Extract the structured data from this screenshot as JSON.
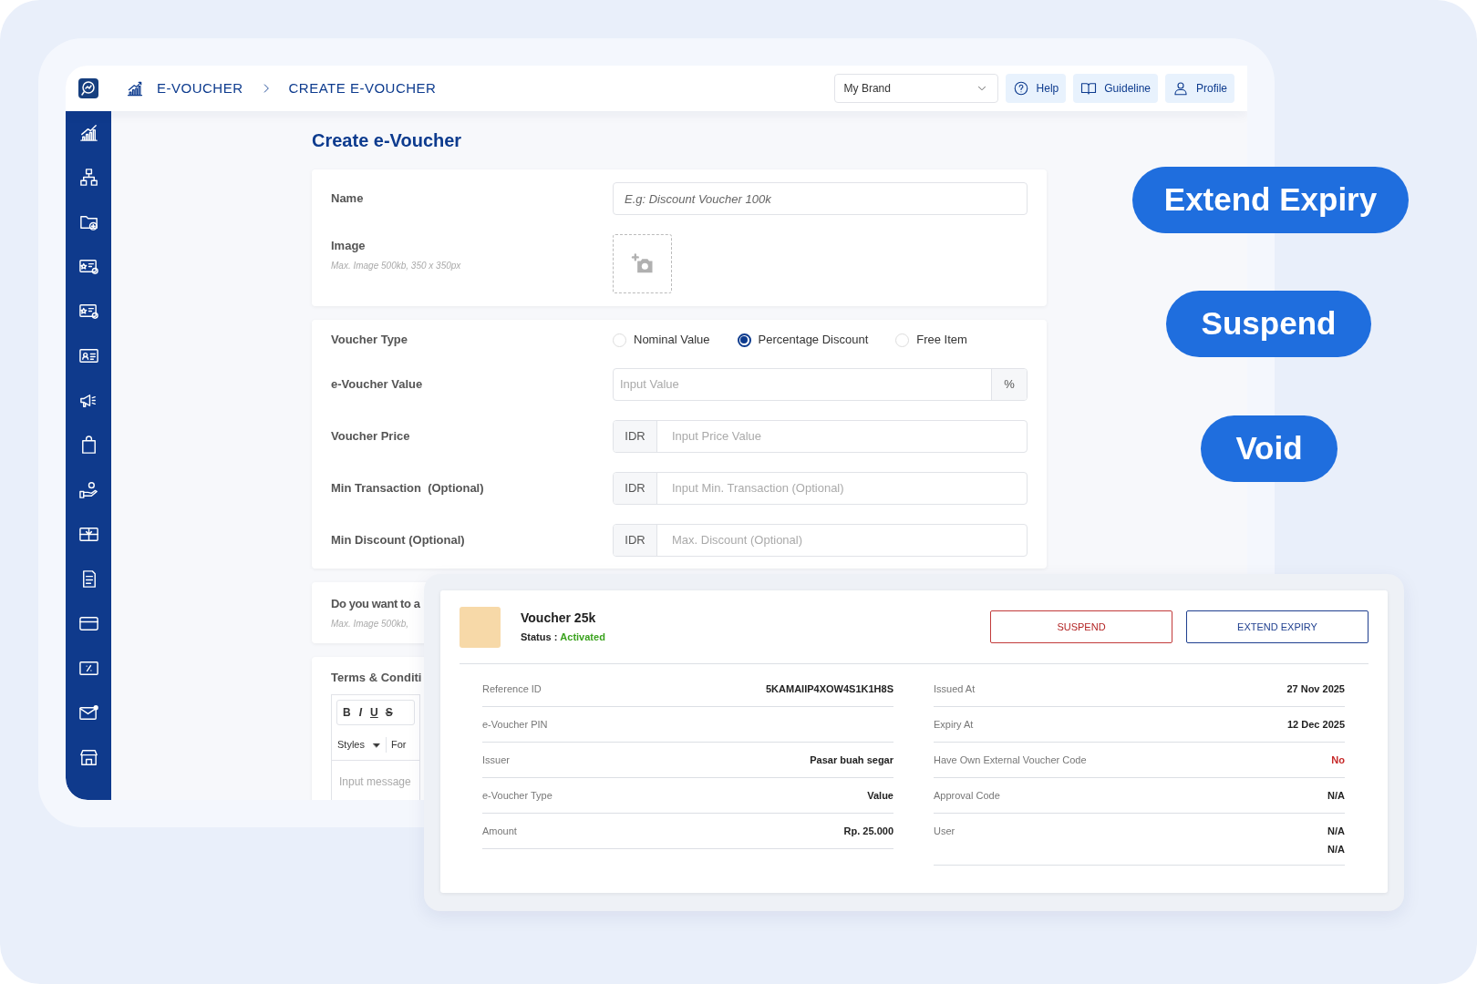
{
  "topbar": {
    "breadcrumb": [
      "E-VOUCHER",
      "CREATE E-VOUCHER"
    ],
    "brand_select": "My Brand",
    "buttons": [
      {
        "kind": "help",
        "label": "Help"
      },
      {
        "kind": "guideline",
        "label": "Guideline"
      },
      {
        "kind": "profile",
        "label": "Profile"
      }
    ]
  },
  "page_title": "Create e-Voucher",
  "basic_card": {
    "name_label": "Name",
    "name_placeholder": "E.g: Discount Voucher 100k",
    "image_label": "Image",
    "image_hint": "Max. Image 500kb, 350 x 350px"
  },
  "voucher_card": {
    "type_label": "Voucher Type",
    "types": [
      {
        "label": "Nominal Value",
        "selected": false
      },
      {
        "label": "Percentage Discount",
        "selected": true
      },
      {
        "label": "Free Item",
        "selected": false
      }
    ],
    "fields": [
      {
        "label": "e-Voucher Value",
        "placeholder": "Input Value",
        "suffix": "%"
      },
      {
        "label": "Voucher Price",
        "prefix": "IDR",
        "placeholder": "Input Price Value"
      },
      {
        "label": "Min Transaction  (Optional)",
        "prefix": "IDR",
        "placeholder": "Input Min. Transaction (Optional)"
      },
      {
        "label": "Min Discount (Optional)",
        "prefix": "IDR",
        "placeholder": "Max. Discount (Optional)"
      }
    ]
  },
  "extra_card": {
    "label": "Do you want to a",
    "hint": "Max. Image 500kb,"
  },
  "terms_card": {
    "label": "Terms & Conditi",
    "format_buttons": [
      "B",
      "I",
      "U",
      "S"
    ],
    "styles_select": "Styles",
    "format_select": "For",
    "placeholder": "Input message"
  },
  "detail": {
    "title": "Voucher 25k",
    "status_label": "Status :",
    "status_value": "Activated",
    "suspend": "SUSPEND",
    "extend": "EXTEND EXPIRY",
    "left_rows": [
      {
        "label": "Reference ID",
        "values": [
          "5KAMAIIP4XOW4S1K1H8S"
        ]
      },
      {
        "label": "e-Voucher PIN",
        "values": []
      },
      {
        "label": "Issuer",
        "values": [
          "Pasar buah segar"
        ]
      },
      {
        "label": "e-Voucher Type",
        "values": [
          "Value"
        ]
      },
      {
        "label": "Amount",
        "values": [
          "Rp. 25.000"
        ]
      }
    ],
    "right_rows": [
      {
        "label": "Issued At",
        "values": [
          "27 Nov 2025"
        ]
      },
      {
        "label": "Expiry At",
        "values": [
          "12 Dec 2025"
        ]
      },
      {
        "label": "Have Own External Voucher Code",
        "values": [
          "No"
        ],
        "color": "#c62828"
      },
      {
        "label": "Approval Code",
        "values": [
          "N/A"
        ]
      },
      {
        "label": "User",
        "values": [
          "N/A",
          "N/A"
        ]
      }
    ]
  },
  "callouts": [
    "Extend Expiry",
    "Suspend",
    "Void"
  ]
}
